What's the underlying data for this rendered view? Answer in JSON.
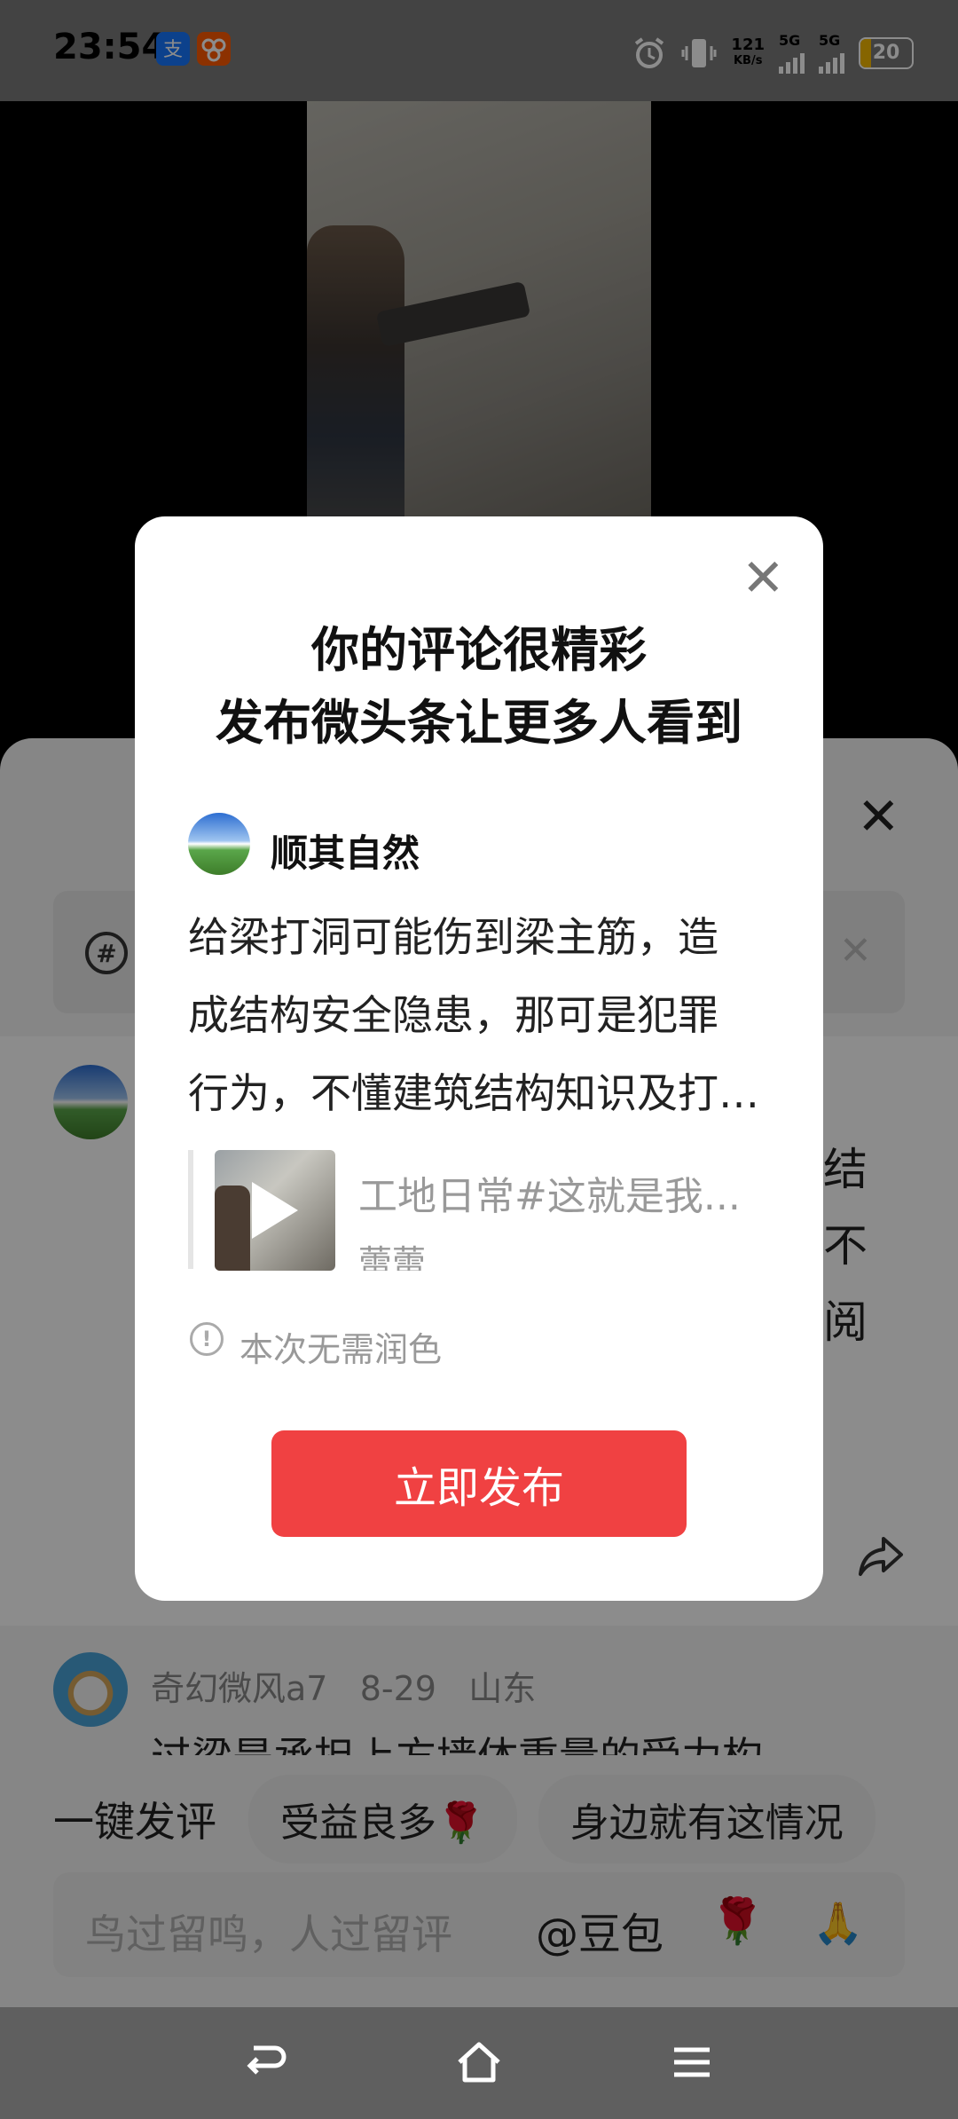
{
  "status_bar": {
    "time": "23:54",
    "net_speed_value": "121",
    "net_speed_unit": "KB/s",
    "sim1_label": "5G",
    "sim2_label": "5G",
    "battery_level": "20",
    "icons": [
      "alipay-icon",
      "taobao-icon",
      "alarm-icon",
      "vibrate-icon",
      "signal-icon",
      "battery-icon"
    ]
  },
  "modal": {
    "title_line1": "你的评论很精彩",
    "title_line2": "发布微头条让更多人看到",
    "user_name": "顺其自然",
    "comment_line1": "给梁打洞可能伤到梁主筋，造",
    "comment_line2": "成结构安全隐患，那可是犯罪",
    "comment_line3": "行为，不懂建筑结构知识及打…",
    "quoted_title": "工地日常#这就是我...",
    "quoted_author": "蕾蕾",
    "hint": "本次无需润色",
    "publish_label": "立即发布",
    "accent_color": "#f04142"
  },
  "background": {
    "visible_chars": [
      "结",
      "不",
      "阅"
    ],
    "second_comment": {
      "user": "奇幻微风a7",
      "date": "8-29",
      "location": "山东",
      "text": "过梁是承担上方墙体重量的受力构"
    },
    "quick_reply_label": "一键发评",
    "chips": [
      "受益良多🌹",
      "身边就有这情况"
    ],
    "input_placeholder": "鸟过留鸣，人过留评",
    "at_label": "@豆包",
    "emoji_rose": "🌹",
    "emoji_pray": "🙏"
  },
  "nav": {
    "icons": [
      "back-icon",
      "home-icon",
      "menu-icon"
    ]
  }
}
